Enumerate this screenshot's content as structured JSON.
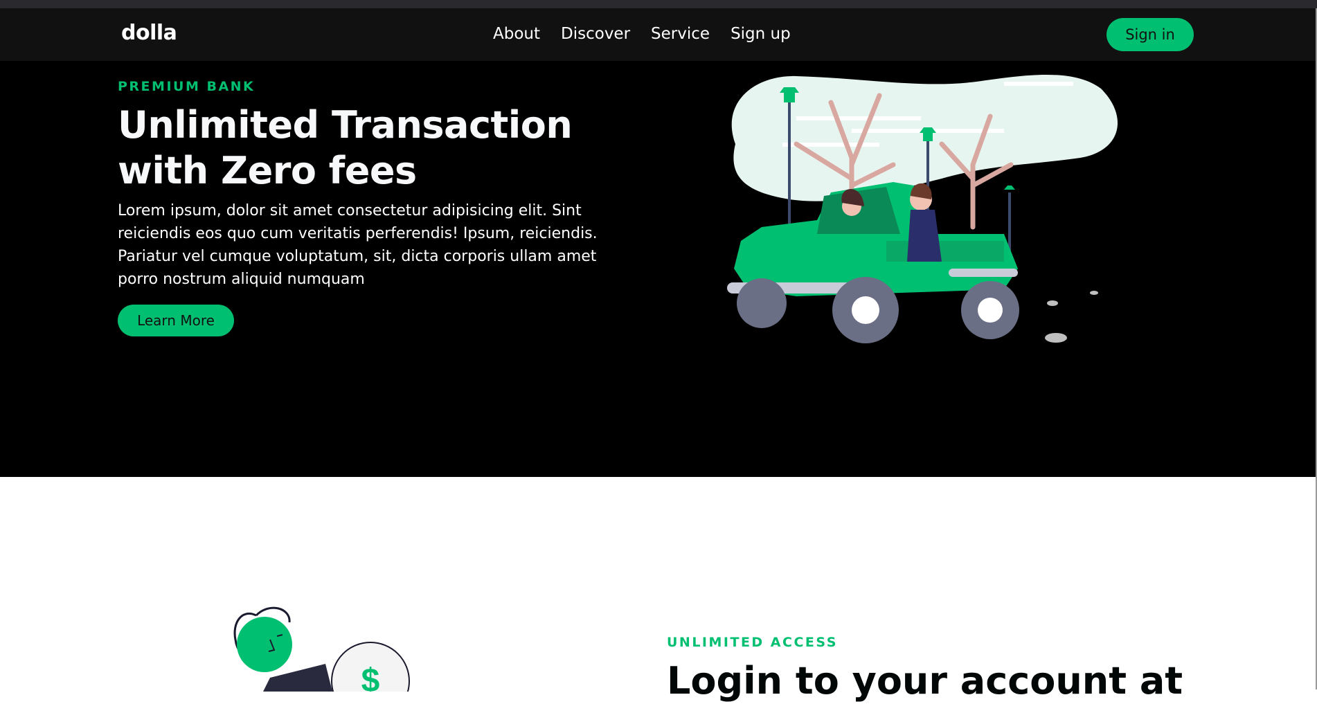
{
  "brand": {
    "logo": "dolla",
    "accent": "#01bf71",
    "nav_bg": "#111111",
    "hero_bg": "#000000"
  },
  "nav": {
    "links": [
      "About",
      "Discover",
      "Service",
      "Sign up"
    ],
    "signin_label": "Sign in"
  },
  "hero": {
    "eyebrow": "PREMIUM BANK",
    "title": "Unlimited Transaction with Zero fees",
    "text": "Lorem ipsum, dolor sit amet consectetur adipisicing elit. Sint reiciendis eos quo cum veritatis perferendis! Ipsum, reiciendis. Pariatur vel cumque voluptatum, sit, dicta corporis ullam amet porro nostrum aliquid numquam",
    "button_label": "Learn More",
    "illustration": "car-with-people-illustration"
  },
  "section2": {
    "eyebrow": "UNLIMITED ACCESS",
    "title": "Login to your account at",
    "illustration": "person-with-coin-illustration",
    "coin_symbol": "$"
  }
}
